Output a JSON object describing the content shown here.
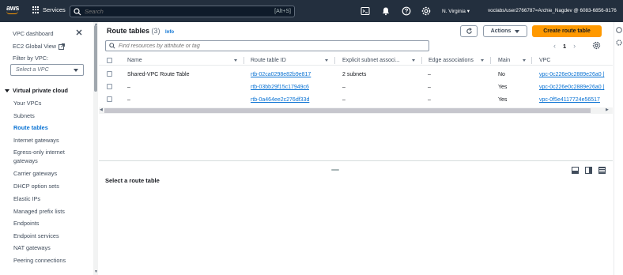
{
  "topnav": {
    "logo": "aws",
    "services_label": "Services",
    "search_placeholder": "Search",
    "search_shortcut": "[Alt+S]",
    "icons": [
      "cloudshell-icon",
      "bell-icon",
      "help-icon",
      "settings-icon"
    ],
    "region": "N. Virginia",
    "account": "voclabs/user2766787=Archie_Nagdev @ 6083-6856-8176"
  },
  "sidebar": {
    "title": "VPC dashboard",
    "global_view": "EC2 Global View",
    "filter_label": "Filter by VPC:",
    "filter_placeholder": "Select a VPC",
    "section": "Virtual private cloud",
    "items": [
      {
        "label": "Your VPCs",
        "active": false
      },
      {
        "label": "Subnets",
        "active": false
      },
      {
        "label": "Route tables",
        "active": true
      },
      {
        "label": "Internet gateways",
        "active": false
      },
      {
        "label": "Egress-only internet gateways",
        "active": false
      },
      {
        "label": "Carrier gateways",
        "active": false
      },
      {
        "label": "DHCP option sets",
        "active": false
      },
      {
        "label": "Elastic IPs",
        "active": false
      },
      {
        "label": "Managed prefix lists",
        "active": false
      },
      {
        "label": "Endpoints",
        "active": false
      },
      {
        "label": "Endpoint services",
        "active": false
      },
      {
        "label": "NAT gateways",
        "active": false
      },
      {
        "label": "Peering connections",
        "active": false
      }
    ]
  },
  "main": {
    "title": "Route tables",
    "count": "(3)",
    "info": "Info",
    "actions_label": "Actions",
    "create_label": "Create route table",
    "filter_placeholder": "Find resources by attribute or tag",
    "page": "1",
    "columns": [
      "Name",
      "Route table ID",
      "Explicit subnet associ...",
      "Edge associations",
      "Main",
      "VPC"
    ],
    "rows": [
      {
        "name": "Shared-VPC Route Table",
        "id": "rtb-02ca0298e82b9e817",
        "subnet": "2 subnets",
        "edge": "–",
        "main": "No",
        "vpc": "vpc-0c226e0c2889e26a0 |"
      },
      {
        "name": "–",
        "id": "rtb-03bb29f15c17949c6",
        "subnet": "–",
        "edge": "–",
        "main": "Yes",
        "vpc": "vpc-0c226e0c2889e26a0 |"
      },
      {
        "name": "–",
        "id": "rtb-0a464ee2c276df33d",
        "subnet": "–",
        "edge": "–",
        "main": "Yes",
        "vpc": "vpc-0f5e4117724e56517"
      }
    ],
    "detail_prompt": "Select a route table"
  },
  "colors": {
    "nav_bg": "#232f3e",
    "accent_orange": "#ff9900",
    "link_blue": "#0972d3"
  }
}
